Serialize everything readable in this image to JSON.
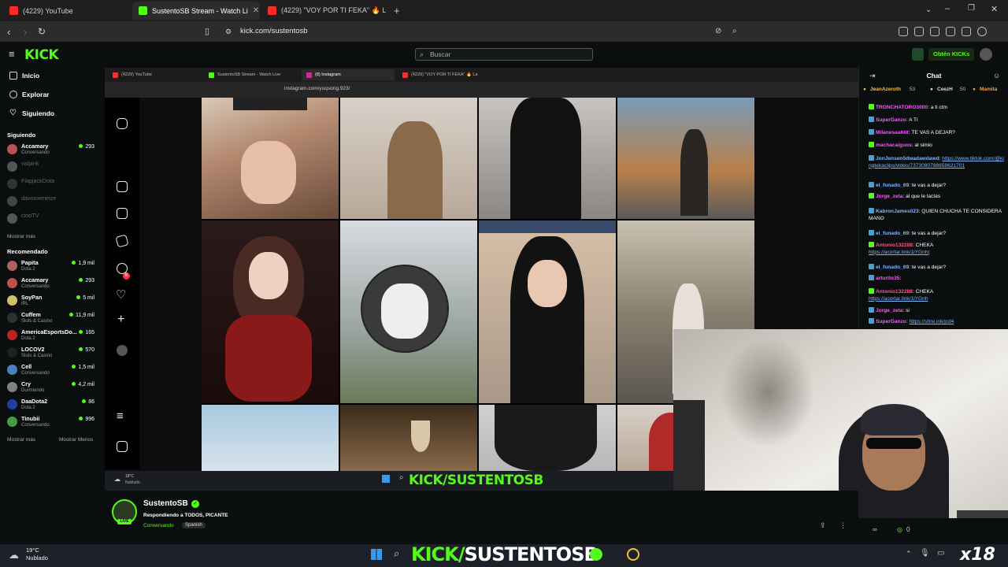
{
  "browser": {
    "tabs": [
      {
        "label": "(4229) YouTube",
        "favicon_color": "#ff2a2a"
      },
      {
        "label": "SustentoSB Stream - Watch Li",
        "favicon_color": "#53fc18",
        "active": true
      },
      {
        "label": "(4229) \"VOY POR TI FEKA\" 🔥 L",
        "favicon_color": "#ff2a2a"
      }
    ],
    "url": "kick.com/sustentosb"
  },
  "kick": {
    "logo": "KICK",
    "search_placeholder": "Buscar",
    "get_kicks": "Obtén KICKs",
    "nav": [
      {
        "label": "Inicio",
        "icon": "home-icon"
      },
      {
        "label": "Explorar",
        "icon": "compass-icon"
      },
      {
        "label": "Siguiendo",
        "icon": "heart-icon"
      }
    ],
    "following_header": "Siguiendo",
    "following": [
      {
        "name": "Accamary",
        "sub": "Conversando",
        "viewers": "293",
        "online": true,
        "color": "#c05050"
      },
      {
        "name": "valpink",
        "sub": "",
        "viewers": "",
        "online": false,
        "color": "#555"
      },
      {
        "name": "FlapjackDota",
        "sub": "",
        "viewers": "",
        "online": false,
        "color": "#333"
      },
      {
        "name": "davooxeneize",
        "sub": "",
        "viewers": "",
        "online": false,
        "color": "#444"
      },
      {
        "name": "cirioTV",
        "sub": "",
        "viewers": "",
        "online": false,
        "color": "#555"
      }
    ],
    "show_more_1": "Mostrar más",
    "recommended_header": "Recomendado",
    "recommended": [
      {
        "name": "Papita",
        "sub": "Dota 2",
        "viewers": "1,9 mil",
        "color": "#b06060"
      },
      {
        "name": "Accamary",
        "sub": "Conversando",
        "viewers": "293",
        "color": "#c05050"
      },
      {
        "name": "SoyPan",
        "sub": "IRL",
        "viewers": "5 mil",
        "color": "#d0c070"
      },
      {
        "name": "Cuffem",
        "sub": "Slots & Casino",
        "viewers": "11,9 mil",
        "color": "#303030"
      },
      {
        "name": "AmericaEsportsDo...",
        "sub": "Dota 2",
        "viewers": "165",
        "color": "#c02020"
      },
      {
        "name": "LOCOV2",
        "sub": "Slots & Casino",
        "viewers": "570",
        "color": "#202020"
      },
      {
        "name": "Cell",
        "sub": "Conversando",
        "viewers": "1,5 mil",
        "color": "#4a80c0"
      },
      {
        "name": "Cry",
        "sub": "Durmiendo",
        "viewers": "4,2 mil",
        "color": "#808080"
      },
      {
        "name": "DaaDota2",
        "sub": "Dota 2",
        "viewers": "86",
        "color": "#2040a0"
      },
      {
        "name": "Tinubii",
        "sub": "Conversando",
        "viewers": "996",
        "color": "#40a040"
      }
    ],
    "show_more_2": "Mostrar más",
    "show_less": "Mostrar Menos"
  },
  "stream_view": {
    "inner_tabs": [
      {
        "label": "(4229) YouTube",
        "favicon_color": "#ff2a2a"
      },
      {
        "label": "SustentoSB Stream - Watch Live",
        "favicon_color": "#53fc18"
      },
      {
        "label": "(8) Instagram",
        "favicon_color": "#d6249f",
        "active": true
      },
      {
        "label": "(4229) \"VOY POR TI FEKA\" 🔥 La",
        "favicon_color": "#ff2a2a"
      }
    ],
    "inner_url": "instagram.com/yuqsong.923/",
    "ig_notification_count": "8",
    "overlay_text": "KICK/SUSTENTOSB",
    "weather_temp": "18°C",
    "weather_desc": "Nublado"
  },
  "chat": {
    "title": "Chat",
    "top_gifters": [
      {
        "name": "JeanAzeroth",
        "count": "53"
      },
      {
        "name": "CeezH",
        "count": "50"
      },
      {
        "name": "Mamita",
        "count": ""
      }
    ],
    "messages": [
      {
        "user": "TRONCHATORO3000",
        "color": "#ff55ff",
        "text": "a ti ctm"
      },
      {
        "user": "SuperGanzo",
        "color": "#ff55ff",
        "text": "A TI"
      },
      {
        "user": "Milanesaahitt",
        "color": "#ff55ff",
        "text": "TE VAS A DEJAR?"
      },
      {
        "user": "machacaiguos",
        "color": "#ff55ff",
        "text": "al simio"
      },
      {
        "user": "JonJensen5dwadawdawd",
        "color": "#7ab8ff",
        "text": "",
        "link": "https://www.tiktok.com/@kingtekaclips/video/7373080788658621701"
      },
      {
        "user": "el_funado_69",
        "color": "#7ab8ff",
        "text": "te vas a dejar?"
      },
      {
        "user": "Jorge_zeta",
        "color": "#ff55ff",
        "text": "al que le lactas"
      },
      {
        "user": "KabronJames023",
        "color": "#7ab8ff",
        "text": "QUIEN CHUCHA TE CONSIDERA MANO"
      },
      {
        "user": "el_funado_69",
        "color": "#7ab8ff",
        "text": "te vas a dejar?"
      },
      {
        "user": "Antonio132288",
        "color": "#ff5588",
        "text": "CHEKA",
        "link": "https://acortar.link/1lYGnh("
      },
      {
        "user": "el_funado_69",
        "color": "#7ab8ff",
        "text": "te vas a dejar?"
      },
      {
        "user": "arturito35",
        "color": "#ff55ff",
        "text": ""
      },
      {
        "user": "Antonio132288",
        "color": "#ff5588",
        "text": "CHEKA",
        "link": "https://acortar.link/1lYGnh"
      },
      {
        "user": "Jorge_zeta",
        "color": "#ff55ff",
        "text": "si"
      },
      {
        "user": "SuperGanzo",
        "color": "#ff55ff",
        "text": "",
        "link": "https://shre.ink/jcd4"
      },
      {
        "user": "SuperGanzo",
        "color": "#ff55ff",
        "text": "",
        "link": "https://shre.ink/jcd4"
      }
    ],
    "stars": "0"
  },
  "streamer": {
    "name": "SustentoSB",
    "title": "Respondiendo a TODOS, PICANTE",
    "category": "Conversando",
    "language": "Spanish",
    "live_label": "LIVE"
  },
  "taskbar": {
    "weather_temp": "19°C",
    "weather_desc": "Nublado",
    "big_overlay_kick": "KICK/",
    "big_overlay_name": "SUSTENTOSB",
    "corner_logo": "x18"
  }
}
